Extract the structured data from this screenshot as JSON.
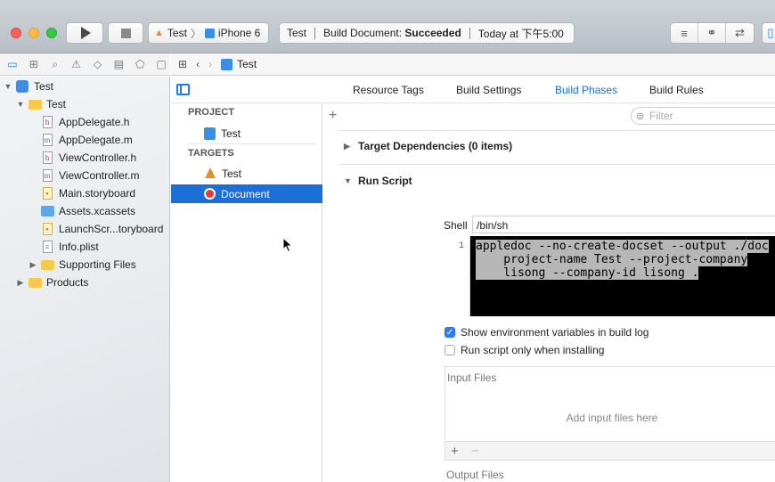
{
  "toolbar": {
    "scheme_target": "Test",
    "scheme_device": "iPhone 6",
    "activity_project": "Test",
    "activity_action": "Build Document:",
    "activity_status": "Succeeded",
    "activity_time": "Today at 下午5:00"
  },
  "jumpbar": {
    "title": "Test"
  },
  "navigator": {
    "items": [
      {
        "label": "Test",
        "depth": 0,
        "kind": "project",
        "disclosure": "▼"
      },
      {
        "label": "Test",
        "depth": 1,
        "kind": "folder",
        "disclosure": "▼"
      },
      {
        "label": "AppDelegate.h",
        "depth": 2,
        "kind": "h"
      },
      {
        "label": "AppDelegate.m",
        "depth": 2,
        "kind": "m"
      },
      {
        "label": "ViewController.h",
        "depth": 2,
        "kind": "h"
      },
      {
        "label": "ViewController.m",
        "depth": 2,
        "kind": "m"
      },
      {
        "label": "Main.storyboard",
        "depth": 2,
        "kind": "storyboard"
      },
      {
        "label": "Assets.xcassets",
        "depth": 2,
        "kind": "assets"
      },
      {
        "label": "LaunchScr...toryboard",
        "depth": 2,
        "kind": "storyboard"
      },
      {
        "label": "Info.plist",
        "depth": 2,
        "kind": "plist"
      },
      {
        "label": "Supporting Files",
        "depth": 2,
        "kind": "folder",
        "disclosure": "▶"
      },
      {
        "label": "Products",
        "depth": 1,
        "kind": "folder",
        "disclosure": "▶"
      }
    ]
  },
  "tabs": {
    "resource_tags": "Resource Tags",
    "build_settings": "Build Settings",
    "build_phases": "Build Phases",
    "build_rules": "Build Rules"
  },
  "targets_panel": {
    "project_header": "PROJECT",
    "project_item": "Test",
    "targets_header": "TARGETS",
    "target_test": "Test",
    "target_document": "Document"
  },
  "phases": {
    "filter_placeholder": "Filter",
    "target_dependencies": "Target Dependencies (0 items)",
    "run_script": "Run Script",
    "shell_label": "Shell",
    "shell_value": "/bin/sh",
    "line_number": "1",
    "script_lines": [
      "appledoc --no-create-docset --output ./doc",
      "    project-name Test --project-company",
      "    lisong --company-id lisong ."
    ],
    "show_env_label": "Show environment variables in build log",
    "show_env_checked": true,
    "run_only_install_label": "Run script only when installing",
    "run_only_install_checked": false,
    "input_files_title": "Input Files",
    "add_input_files": "Add input files here",
    "output_files_title": "Output Files"
  },
  "colors": {
    "selection": "#1c6fd7",
    "accent": "#1a6fe0"
  }
}
